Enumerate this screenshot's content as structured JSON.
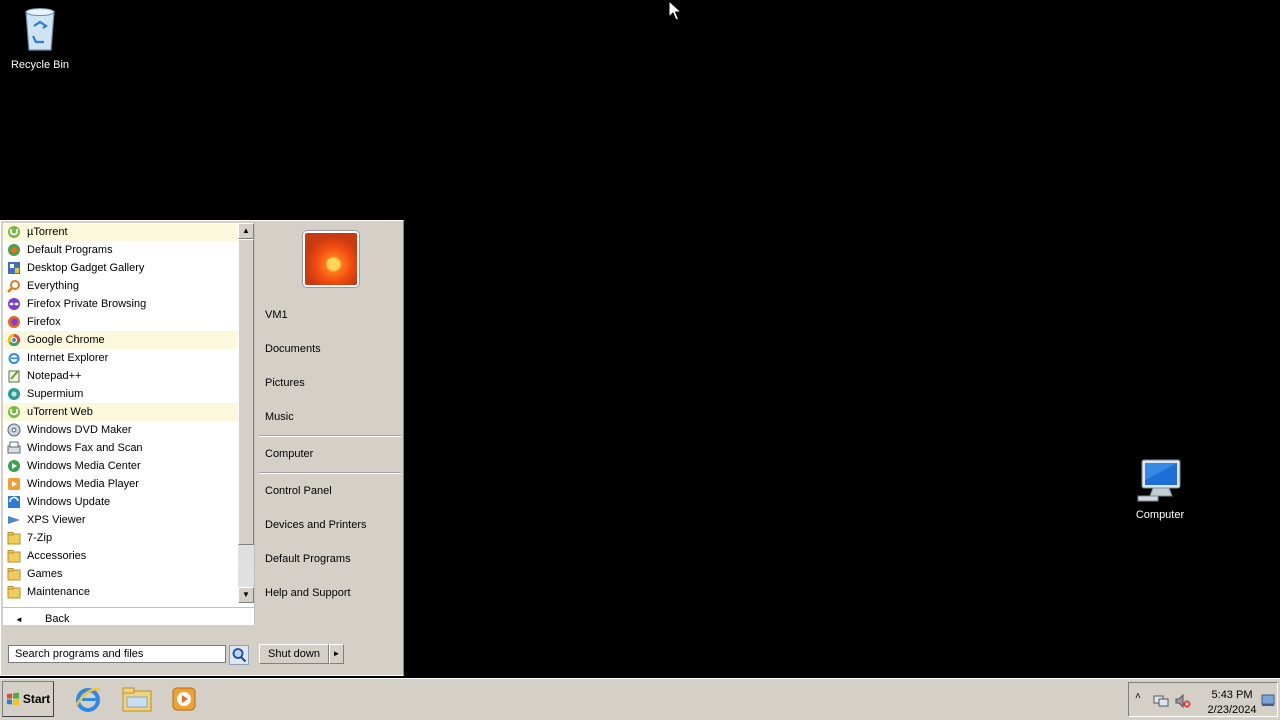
{
  "desktop": {
    "recycle_bin_label": "Recycle Bin",
    "computer_label": "Computer"
  },
  "start_menu": {
    "programs": [
      {
        "label": "µTorrent",
        "icon": "utorrent-icon",
        "highlight": true
      },
      {
        "label": "Default Programs",
        "icon": "default-programs-icon",
        "highlight": false
      },
      {
        "label": "Desktop Gadget Gallery",
        "icon": "gadget-gallery-icon",
        "highlight": false
      },
      {
        "label": "Everything",
        "icon": "everything-icon",
        "highlight": false
      },
      {
        "label": "Firefox Private Browsing",
        "icon": "firefox-private-icon",
        "highlight": false
      },
      {
        "label": "Firefox",
        "icon": "firefox-icon",
        "highlight": false
      },
      {
        "label": "Google Chrome",
        "icon": "chrome-icon",
        "highlight": true
      },
      {
        "label": "Internet Explorer",
        "icon": "internet-explorer-icon",
        "highlight": false
      },
      {
        "label": "Notepad++",
        "icon": "notepadpp-icon",
        "highlight": false
      },
      {
        "label": "Supermium",
        "icon": "supermium-icon",
        "highlight": false
      },
      {
        "label": "uTorrent Web",
        "icon": "utorrent-web-icon",
        "highlight": true
      },
      {
        "label": "Windows DVD Maker",
        "icon": "dvd-maker-icon",
        "highlight": false
      },
      {
        "label": "Windows Fax and Scan",
        "icon": "fax-scan-icon",
        "highlight": false
      },
      {
        "label": "Windows Media Center",
        "icon": "media-center-icon",
        "highlight": false
      },
      {
        "label": "Windows Media Player",
        "icon": "media-player-icon",
        "highlight": false
      },
      {
        "label": "Windows Update",
        "icon": "windows-update-icon",
        "highlight": false
      },
      {
        "label": "XPS Viewer",
        "icon": "xps-viewer-icon",
        "highlight": false
      },
      {
        "label": "7-Zip",
        "icon": "folder-icon",
        "highlight": false
      },
      {
        "label": "Accessories",
        "icon": "folder-icon",
        "highlight": false
      },
      {
        "label": "Games",
        "icon": "folder-icon",
        "highlight": false
      },
      {
        "label": "Maintenance",
        "icon": "folder-icon",
        "highlight": false
      }
    ],
    "back_label": "Back",
    "search_placeholder": "Search programs and files",
    "right": {
      "user": "VM1",
      "documents": "Documents",
      "pictures": "Pictures",
      "music": "Music",
      "computer": "Computer",
      "control_panel": "Control Panel",
      "devices": "Devices and Printers",
      "default_programs": "Default Programs",
      "help": "Help and Support"
    },
    "shutdown_label": "Shut down"
  },
  "taskbar": {
    "start_label": "Start",
    "clock_time": "5:43 PM",
    "clock_date": "2/23/2024"
  }
}
